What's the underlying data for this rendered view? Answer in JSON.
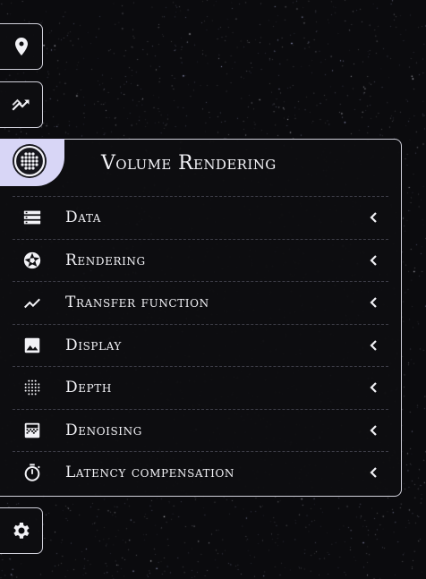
{
  "panel": {
    "title": "Volume Rendering",
    "tab_icon": "volume-sphere-icon",
    "items": [
      {
        "label": "Data",
        "icon": "database-icon"
      },
      {
        "label": "Rendering",
        "icon": "aperture-icon"
      },
      {
        "label": "Transfer function",
        "icon": "trend-line-icon"
      },
      {
        "label": "Display",
        "icon": "image-icon"
      },
      {
        "label": "Depth",
        "icon": "dither-dots-icon"
      },
      {
        "label": "Denoising",
        "icon": "gradient-square-icon"
      },
      {
        "label": "Latency compensation",
        "icon": "timer-icon"
      }
    ]
  },
  "sidebar": {
    "buttons": [
      {
        "icon": "location-pin-icon"
      },
      {
        "icon": "analytics-icon"
      },
      {
        "icon": "gear-icon"
      }
    ]
  },
  "colors": {
    "background": "#0b0b0e",
    "panel": "#0e0e11",
    "accent_tab": "#d8d6f6",
    "border": "#d0d0da",
    "text": "#f2f2f6"
  }
}
